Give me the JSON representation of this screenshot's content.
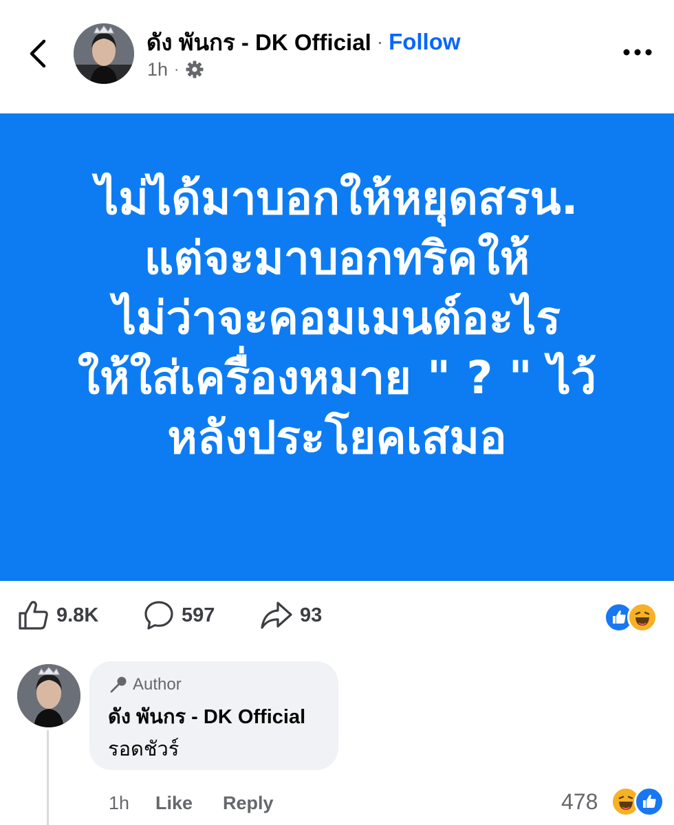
{
  "header": {
    "page_name": "ดัง พันกร - DK Official",
    "separator": "·",
    "follow_label": "Follow",
    "time": "1h",
    "meta_separator": "·",
    "icons": {
      "back": "chevron-left-icon",
      "audience": "gear-icon",
      "more": "more-horizontal-icon"
    }
  },
  "post": {
    "background_color": "#0d7cf2",
    "text_color": "#ffffff",
    "lines": [
      "ไม่ได้มาบอกให้หยุดสรน.",
      "แต่จะมาบอกทริคให้",
      "ไม่ว่าจะคอมเมนต์อะไร",
      "ให้ใส่เครื่องหมาย \" ? \" ไว้",
      "หลังประโยคเสมอ"
    ]
  },
  "actions": {
    "likes": "9.8K",
    "comments": "597",
    "shares": "93",
    "reaction_icons": [
      "like-reaction-icon",
      "haha-reaction-icon"
    ]
  },
  "comment": {
    "badge": "Author",
    "name": "ดัง พันกร - DK Official",
    "text": "รอดชัวร์",
    "time": "1h",
    "like_label": "Like",
    "reply_label": "Reply",
    "reaction_count": "478",
    "reaction_icons": [
      "haha-reaction-icon",
      "like-reaction-icon"
    ]
  },
  "colors": {
    "accent": "#0866ff",
    "secondary_text": "#65676b",
    "bubble": "#f0f2f5"
  }
}
